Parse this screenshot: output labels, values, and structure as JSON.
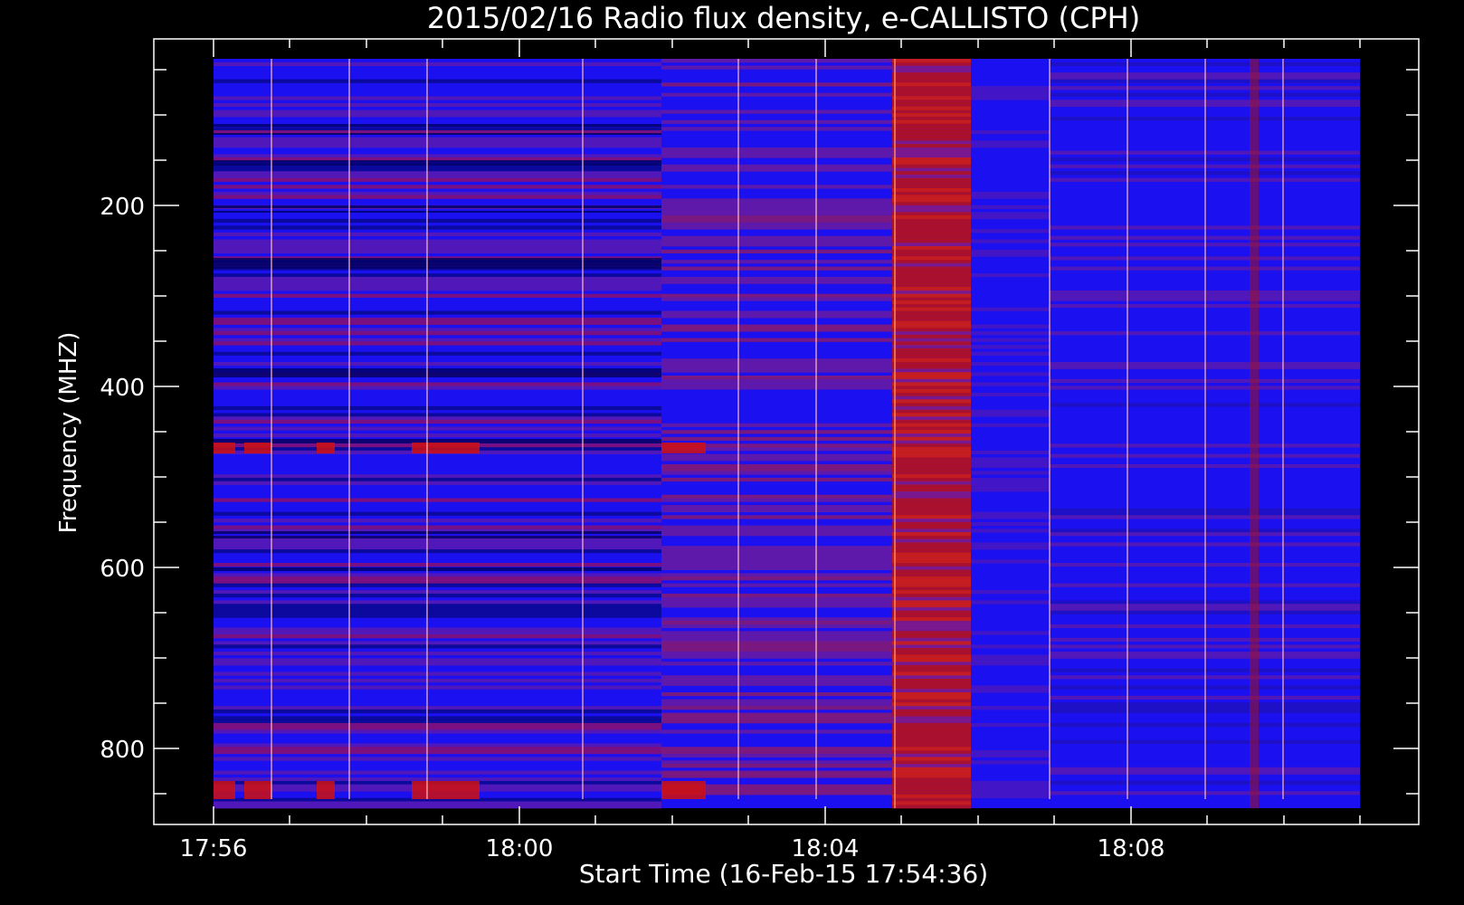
{
  "chart_data": {
    "type": "heatmap",
    "title": "2015/02/16  Radio flux density, e-CALLISTO (CPH)",
    "xlabel": "Start Time (16-Feb-15 17:54:36)",
    "ylabel": "Frequency (MHZ)",
    "x_tick_labels": [
      "17:56",
      "18:00",
      "18:04",
      "18:08"
    ],
    "y_tick_labels": [
      "200",
      "400",
      "600",
      "800"
    ],
    "y_ticks": [
      200,
      400,
      600,
      800
    ],
    "ylim": [
      884,
      16
    ],
    "y_inverted": true,
    "data_y_range": [
      38,
      866
    ],
    "colormap": [
      "#000000",
      "#0000ff",
      "#d00000",
      "#ff2000"
    ],
    "background": "#000000",
    "axis_color": "#ffffff"
  }
}
